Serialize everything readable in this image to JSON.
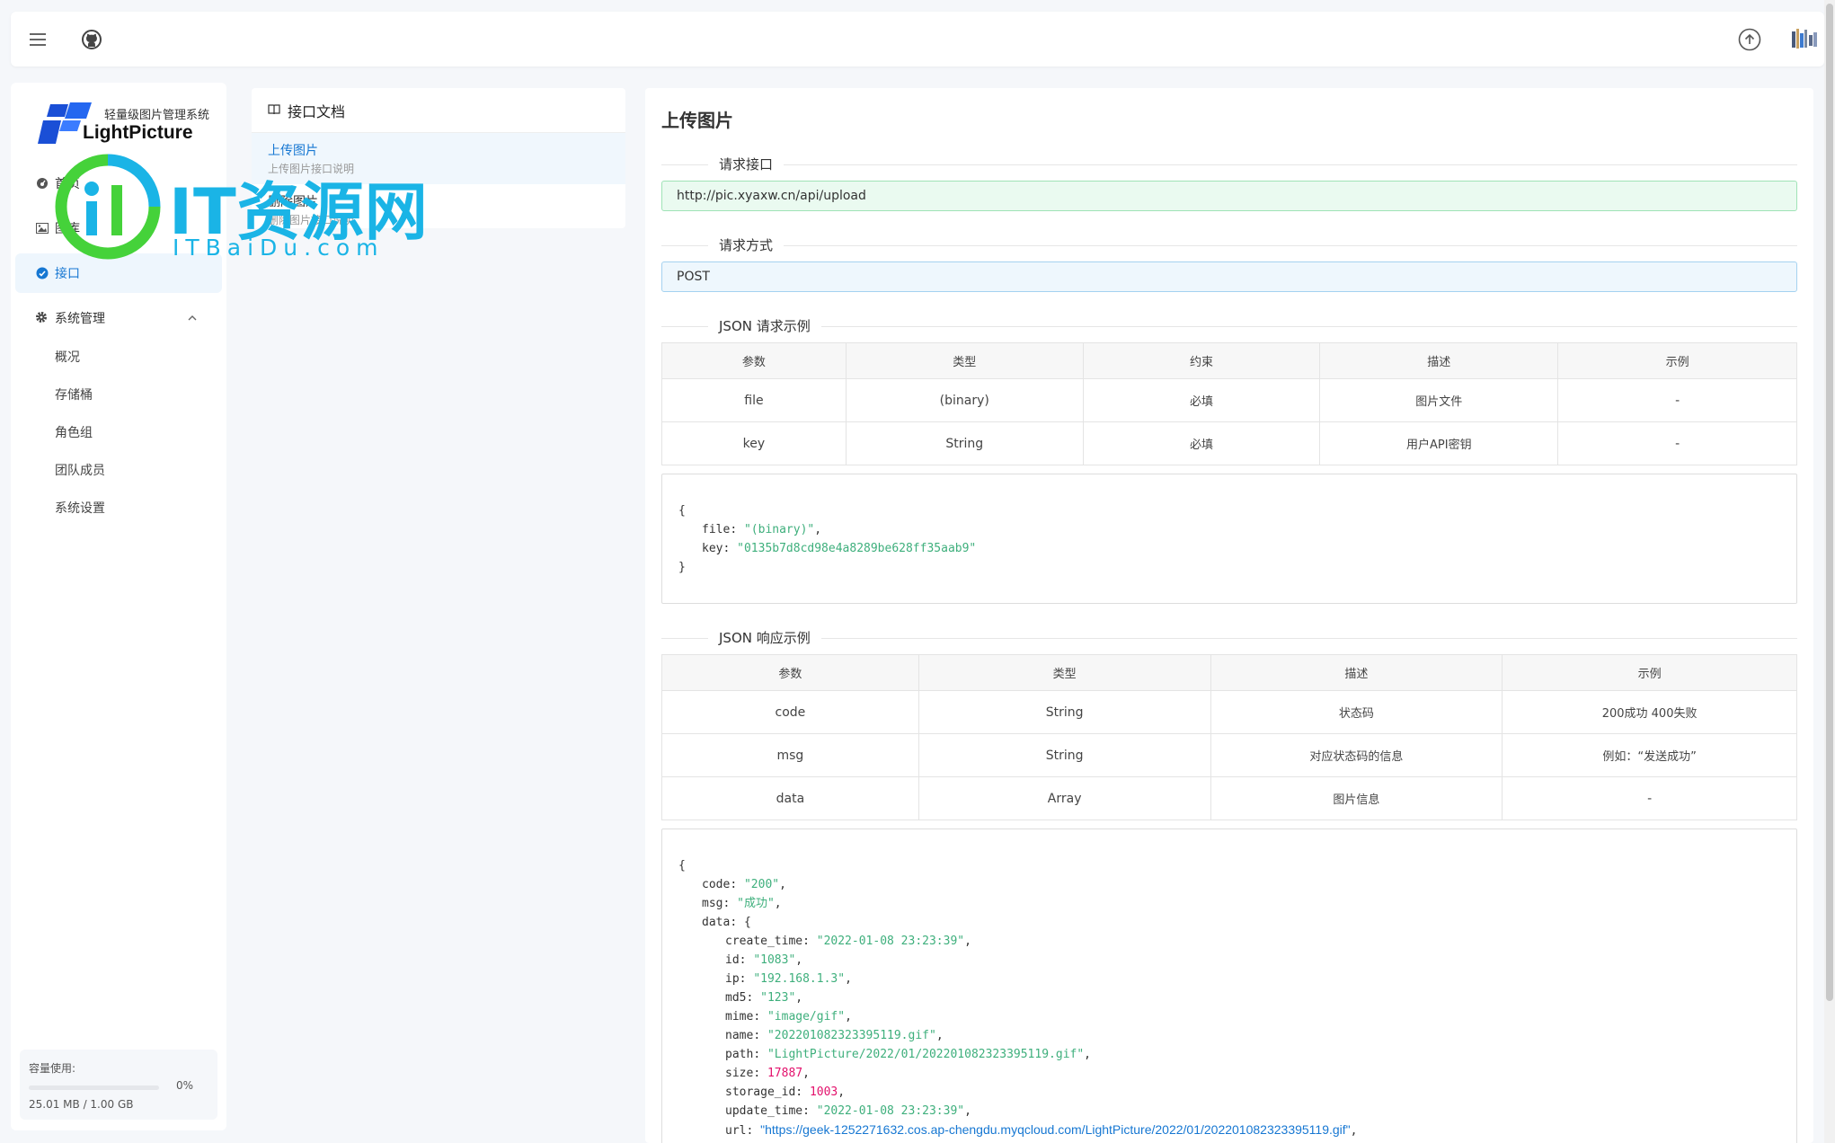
{
  "topbar": {
    "menu_icon": "hamburger-icon",
    "github_icon": "github-icon",
    "upload_icon": "upload-icon",
    "avatar_icon": "avatar"
  },
  "sidebar": {
    "logo_subtitle": "轻量级图片管理系统",
    "logo_title": "LightPicture",
    "items": [
      {
        "label": "首页",
        "icon": "dashboard-icon"
      },
      {
        "label": "图库",
        "icon": "image-icon"
      },
      {
        "label": "接口",
        "icon": "api-icon",
        "active": true
      }
    ],
    "group": {
      "label": "系统管理",
      "icon": "gear-icon"
    },
    "sub_items": [
      "概况",
      "存储桶",
      "角色组",
      "团队成员",
      "系统设置"
    ],
    "quota": {
      "label": "容量使用:",
      "percent": "0%",
      "size": "25.01 MB / 1.00 GB"
    }
  },
  "doc_panel": {
    "title": "接口文档",
    "items": [
      {
        "title": "上传图片",
        "desc": "上传图片接口说明"
      },
      {
        "title": "删除图片",
        "desc": "删除图片接口说明"
      }
    ]
  },
  "watermark": {
    "text": "IT资源网",
    "sub": "ITBaiDu.com"
  },
  "content": {
    "title": "上传图片",
    "section_url": "请求接口",
    "url": "http://pic.xyaxw.cn/api/upload",
    "section_method": "请求方式",
    "method": "POST",
    "section_req": "JSON 请求示例",
    "req_table": {
      "headers": [
        "参数",
        "类型",
        "约束",
        "描述",
        "示例"
      ],
      "rows": [
        [
          "file",
          "(binary)",
          "必填",
          "图片文件",
          "-"
        ],
        [
          "key",
          "String",
          "必填",
          "用户API密钥",
          "-"
        ]
      ]
    },
    "req_code": {
      "open": "{",
      "file_key": "file",
      "file_val": "\"(binary)\"",
      "key_key": "key",
      "key_val": "\"0135b7d8cd98e4a8289be628ff35aab9\"",
      "close": "}"
    },
    "section_resp": "JSON 响应示例",
    "resp_table": {
      "headers": [
        "参数",
        "类型",
        "描述",
        "示例"
      ],
      "rows": [
        [
          "code",
          "String",
          "状态码",
          "200成功 400失败"
        ],
        [
          "msg",
          "String",
          "对应状态码的信息",
          "例如：“发送成功”"
        ],
        [
          "data",
          "Array",
          "图片信息",
          "-"
        ]
      ]
    },
    "resp_code": {
      "open": "{",
      "code_key": "code",
      "code_val": "\"200\"",
      "msg_key": "msg",
      "msg_val": "\"成功\"",
      "data_key": "data",
      "create_time_key": "create_time",
      "create_time_val": "\"2022-01-08 23:23:39\"",
      "id_key": "id",
      "id_val": "\"1083\"",
      "ip_key": "ip",
      "ip_val": "\"192.168.1.3\"",
      "md5_key": "md5",
      "md5_val": "\"123\"",
      "mime_key": "mime",
      "mime_val": "\"image/gif\"",
      "name_key": "name",
      "name_val": "\"202201082323395119.gif\"",
      "path_key": "path",
      "path_val": "\"LightPicture/2022/01/202201082323395119.gif\"",
      "size_key": "size",
      "size_val": "17887",
      "storage_id_key": "storage_id",
      "storage_id_val": "1003",
      "update_time_key": "update_time",
      "update_time_val": "\"2022-01-08 23:23:39\"",
      "url_key": "url",
      "url_val": "\"https://geek-1252271632.cos.ap-chengdu.myqcloud.com/LightPicture/2022/01/202201082323395119.gif\""
    }
  },
  "colors": {
    "accent": "#1677d2",
    "url_bg": "#eafaf0",
    "method_bg": "#eef7fd",
    "string": "#3eaf7c",
    "number": "#e3116c",
    "watermark": "#1ab4e6"
  }
}
